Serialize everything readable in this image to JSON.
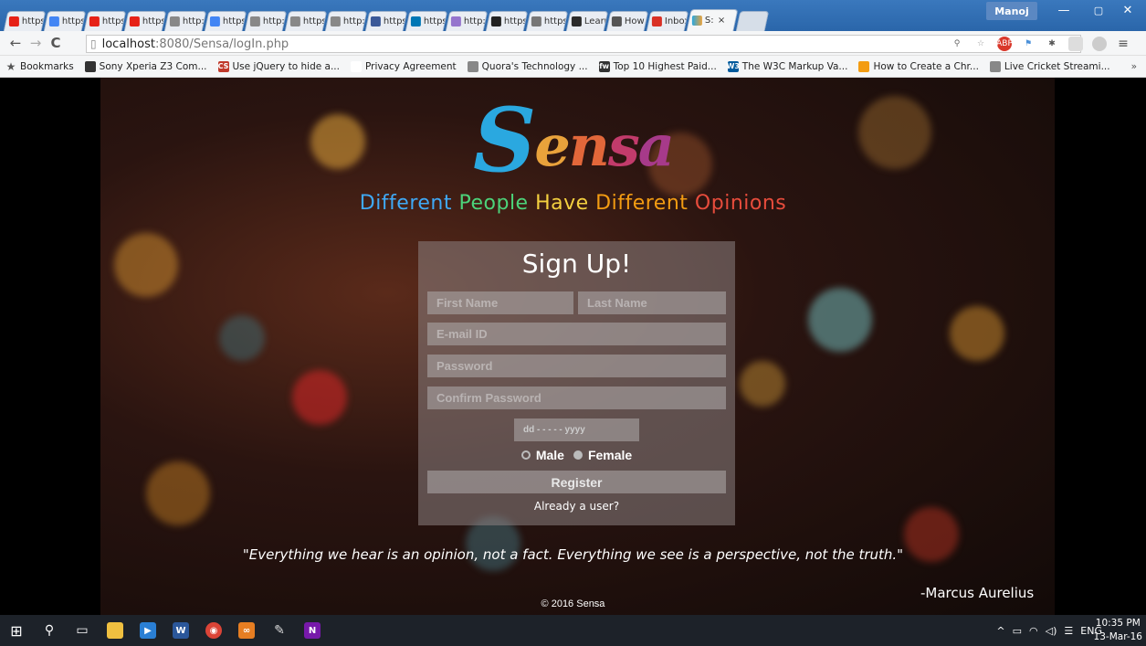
{
  "browser": {
    "tabs": [
      {
        "label": "https",
        "color": "#e62117"
      },
      {
        "label": "https",
        "color": "#4285f4"
      },
      {
        "label": "https",
        "color": "#e62117"
      },
      {
        "label": "https",
        "color": "#e62117"
      },
      {
        "label": "http:",
        "color": "#888888"
      },
      {
        "label": "https",
        "color": "#4285f4"
      },
      {
        "label": "http:",
        "color": "#888888"
      },
      {
        "label": "https",
        "color": "#888888"
      },
      {
        "label": "http:",
        "color": "#888888"
      },
      {
        "label": "https",
        "color": "#3b5998"
      },
      {
        "label": "https",
        "color": "#0077b5"
      },
      {
        "label": "http:",
        "color": "#9575cd"
      },
      {
        "label": "https",
        "color": "#222222"
      },
      {
        "label": "https",
        "color": "#777777"
      },
      {
        "label": "Learn",
        "color": "#2b2b2b"
      },
      {
        "label": "How",
        "color": "#555555"
      },
      {
        "label": "Inbox",
        "color": "#d93025"
      }
    ],
    "active_tab": {
      "label": "S:",
      "close": "×"
    },
    "user": "Manoj",
    "window_buttons": {
      "minimize": "—",
      "restore": "▢",
      "close": "✕"
    },
    "nav": {
      "back": "←",
      "forward": "→",
      "reload": "C"
    },
    "url": {
      "host": "localhost",
      "path": ":8080/Sensa/logIn.php"
    },
    "bookmarks": [
      {
        "label": "Bookmarks",
        "icon": "★",
        "color": "#555555"
      },
      {
        "label": "Sony Xperia Z3 Com...",
        "icon": "",
        "color": "#333333"
      },
      {
        "label": "Use jQuery to hide a...",
        "icon": "CS",
        "color": "#c0392b"
      },
      {
        "label": "Privacy Agreement",
        "icon": "",
        "color": "#ffffff"
      },
      {
        "label": "Quora's Technology ...",
        "icon": "",
        "color": "#888888"
      },
      {
        "label": "Top 10 Highest Paid...",
        "icon": "fw",
        "color": "#333333"
      },
      {
        "label": "The W3C Markup Va...",
        "icon": "W3",
        "color": "#005a9c"
      },
      {
        "label": "How to Create a Chr...",
        "icon": "",
        "color": "#f39c12"
      },
      {
        "label": "Live Cricket Streami...",
        "icon": "",
        "color": "#888888"
      }
    ],
    "bookmarks_more": "»"
  },
  "page": {
    "logo_first": "S",
    "logo_rest": [
      "e",
      "n",
      "s",
      "a"
    ],
    "logo_colors": [
      "#e9a23b",
      "#e2673a",
      "#c23b6b",
      "#a73a8a"
    ],
    "tagline": [
      {
        "text": "Different ",
        "color": "#3fa9f5"
      },
      {
        "text": "People ",
        "color": "#4cd37a"
      },
      {
        "text": "Have ",
        "color": "#f4d03f"
      },
      {
        "text": "Different ",
        "color": "#f39c12"
      },
      {
        "text": "Opinions",
        "color": "#e74c3c"
      }
    ],
    "signup": {
      "title": "Sign Up!",
      "first_name_placeholder": "First Name",
      "last_name_placeholder": "Last Name",
      "email_placeholder": "E-mail ID",
      "password_placeholder": "Password",
      "confirm_password_placeholder": "Confirm Password",
      "dob_placeholder": "dd - - - - - yyyy",
      "gender_male": "Male",
      "gender_female": "Female",
      "register_label": "Register",
      "already_user": "Already a user?"
    },
    "quote": "\"Everything we hear is an opinion, not a fact. Everything we see is a perspective, not the truth.\"",
    "author": "-Marcus Aurelius",
    "copyright": "© 2016 Sensa"
  },
  "taskbar": {
    "tray_lang": "ENG",
    "time": "10:35 PM",
    "date": "13-Mar-16"
  }
}
